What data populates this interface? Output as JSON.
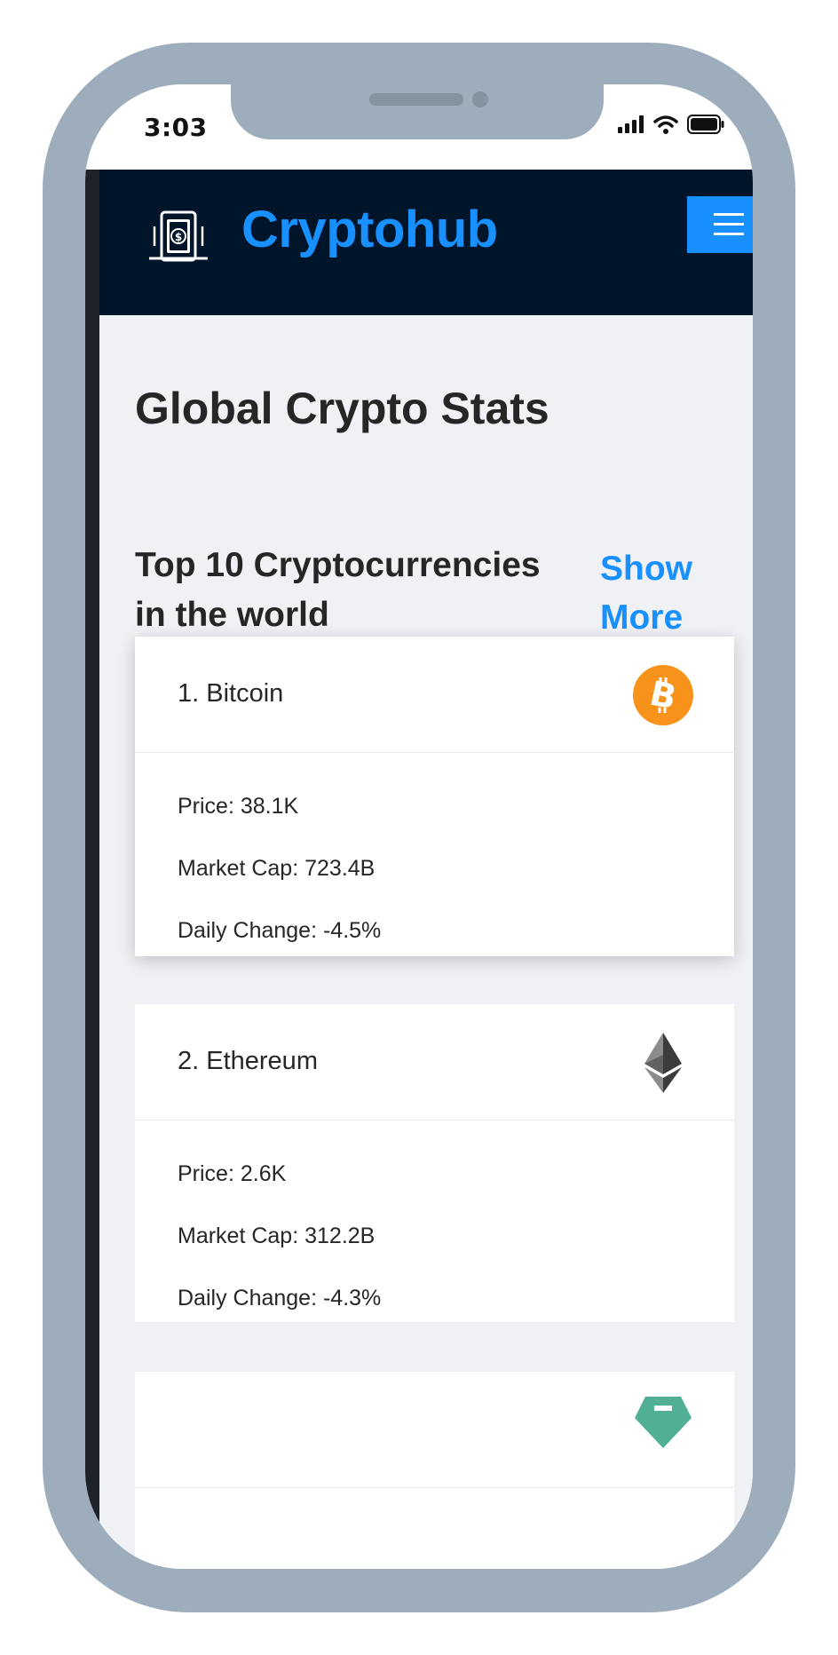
{
  "status_bar": {
    "time": "3:03"
  },
  "navbar": {
    "brand": "Cryptohub"
  },
  "page": {
    "title": "Global Crypto Stats"
  },
  "section": {
    "title": "Top 10 Cryptocurrencies in the world",
    "show_more_label": "Show More"
  },
  "cryptos": [
    {
      "title": "1. Bitcoin",
      "price": "Price: 38.1K",
      "market_cap": "Market Cap: 723.4B",
      "daily_change": "Daily Change: -4.5%",
      "icon": "bitcoin-icon",
      "icon_color": "#f7931a"
    },
    {
      "title": "2. Ethereum",
      "price": "Price: 2.6K",
      "market_cap": "Market Cap: 312.2B",
      "daily_change": "Daily Change: -4.3%",
      "icon": "ethereum-icon",
      "icon_color": "#3c3c3d"
    },
    {
      "icon": "tether-icon",
      "icon_color": "#50af95"
    }
  ],
  "colors": {
    "accent": "#1890ff",
    "navbar_bg": "#001529",
    "page_bg": "#eff1f5",
    "frame": "#9dadbb"
  }
}
